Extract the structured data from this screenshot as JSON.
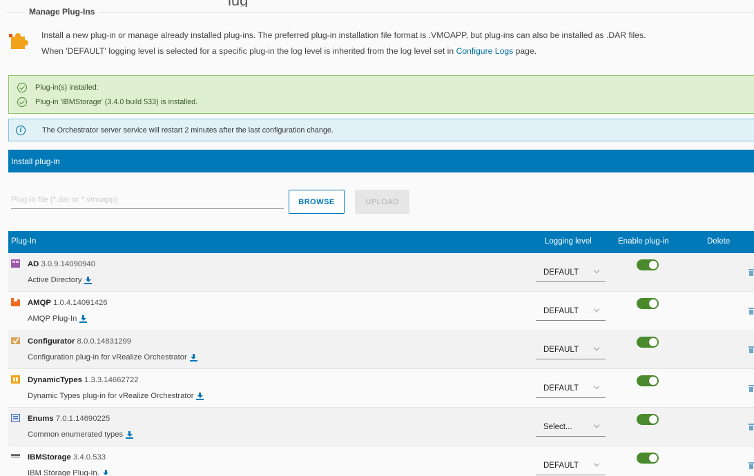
{
  "header": {
    "partial_title": "lug",
    "section_legend": "Manage Plug-Ins",
    "description_line1": "Install a new plug-in or manage already installed plug-ins. The preferred plug-in installation file format is .VMOAPP, but plug-ins can also be installed as .DAR files.",
    "description_line2_prefix": "When 'DEFAULT' logging level is selected for a specific plug-in the log level is inherited from the log level set in ",
    "description_link": "Configure Logs",
    "description_line2_suffix": " page."
  },
  "alerts": {
    "success": [
      "Plug-in(s) installed:",
      "Plug-in 'IBMStorage' (3.4.0 build 533) is installed."
    ],
    "info": "The Orchestrator server service will restart 2 minutes after the last configuration change."
  },
  "install": {
    "title": "Install plug-in",
    "file_placeholder": "Plug-in file (*.dar or *.vmoapp)",
    "browse_label": "BROWSE",
    "upload_label": "UPLOAD"
  },
  "table": {
    "headers": {
      "plugin": "Plug-In",
      "logging": "Logging level",
      "enable": "Enable plug-in",
      "delete": "Delete"
    },
    "rows": [
      {
        "name": "AD",
        "version": "3.0.9.14090940",
        "description": "Active Directory",
        "logging": "DEFAULT",
        "enabled": true,
        "icon": "active-directory-icon",
        "icon_color": "#9b5aa8"
      },
      {
        "name": "AMQP",
        "version": "1.0.4.14091426",
        "description": "AMQP Plug-In",
        "logging": "DEFAULT",
        "enabled": true,
        "icon": "amqp-icon",
        "icon_color": "#f26a22"
      },
      {
        "name": "Configurator",
        "version": "8.0.0.14831299",
        "description": "Configuration plug-in for vRealize Orchestrator",
        "logging": "DEFAULT",
        "enabled": true,
        "icon": "configurator-icon",
        "icon_color": "#d9a35a"
      },
      {
        "name": "DynamicTypes",
        "version": "1.3.3.14662722",
        "description": "Dynamic Types plug-in for vRealize Orchestrator",
        "logging": "DEFAULT",
        "enabled": true,
        "icon": "dynamic-types-icon",
        "icon_color": "#f2a31a"
      },
      {
        "name": "Enums",
        "version": "7.0.1.14690225",
        "description": "Common enumerated types",
        "logging": "Select...",
        "enabled": true,
        "icon": "enums-icon",
        "icon_color": "#4a6fb5"
      },
      {
        "name": "IBMStorage",
        "version": "3.4.0.533",
        "description": "IBM Storage Plug-In.",
        "logging": "DEFAULT",
        "enabled": true,
        "icon": "ibm-logo-icon",
        "icon_color": "#444444"
      }
    ]
  },
  "colors": {
    "brand_blue": "#0079b8",
    "toggle_on": "#4a8a2d",
    "success_bg": "#dff0d0",
    "info_bg": "#e1f1f6"
  }
}
